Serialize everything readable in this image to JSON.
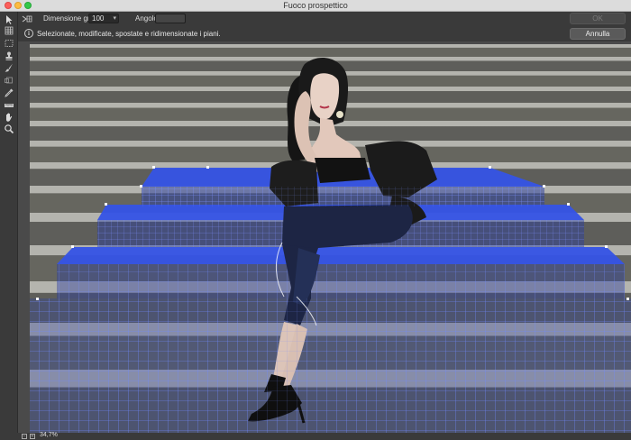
{
  "window": {
    "title": "Fuoco prospettico"
  },
  "toolbar": {
    "grid_size_label": "Dimensione griglia:",
    "grid_size_value": "100",
    "angle_label": "Angolo:",
    "angle_value": "",
    "ok_label": "OK"
  },
  "infobar": {
    "message": "Selezionate, modificate, spostate e ridimensionate i piani.",
    "cancel_label": "Annulla"
  },
  "tools": [
    {
      "name": "edit-plane-tool",
      "icon": "arrow-pointer-icon"
    },
    {
      "name": "create-plane-tool",
      "icon": "grid-plane-icon"
    },
    {
      "name": "marquee-tool",
      "icon": "marquee-icon"
    },
    {
      "name": "stamp-tool",
      "icon": "stamp-icon"
    },
    {
      "name": "brush-tool",
      "icon": "brush-icon"
    },
    {
      "name": "transform-tool",
      "icon": "transform-icon"
    },
    {
      "name": "eyedropper-tool",
      "icon": "eyedropper-icon"
    },
    {
      "name": "measure-tool",
      "icon": "ruler-icon"
    },
    {
      "name": "hand-tool",
      "icon": "hand-icon"
    },
    {
      "name": "zoom-tool",
      "icon": "magnifier-icon"
    }
  ],
  "status": {
    "zoom": "34,7%"
  },
  "colors": {
    "plane_fill": "#2f4fd8",
    "plane_grid": "#5a74ff",
    "panel": "#3a3a3a"
  }
}
